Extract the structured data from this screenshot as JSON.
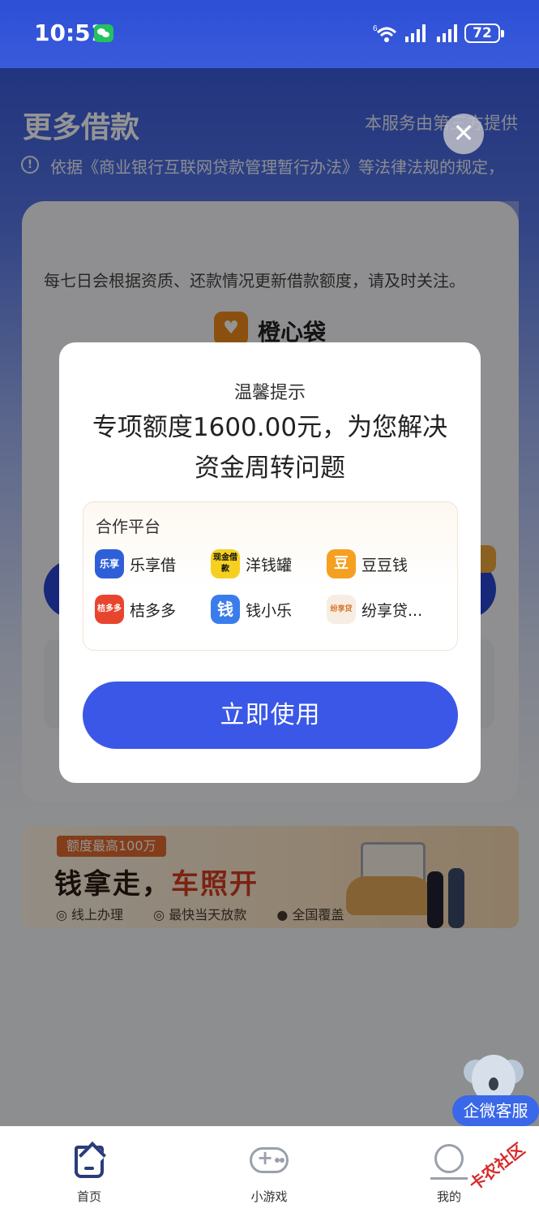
{
  "status_bar": {
    "time": "10:51",
    "battery": "72",
    "wifi_label": "6"
  },
  "page": {
    "title": "更多借款",
    "provider_note": "本服务由第三方提供",
    "notice": "依据《商业银行互联网贷款管理暂行办法》等法律法规的规定，",
    "card_tip": "每七日会根据资质、还款情况更新借款额度，请及时关注。",
    "brand_name": "橙心袋"
  },
  "banner": {
    "tag": "额度最高100万",
    "headline_a": "钱拿走，",
    "headline_b": "车照开",
    "points": [
      "线上办理",
      "最快当天放款",
      "全国覆盖"
    ]
  },
  "dialog": {
    "title": "温馨提示",
    "headline": "专项额度1600.00元，为您解决资金周转问题",
    "partner_title": "合作平台",
    "partners": [
      {
        "name": "乐享借",
        "icon": "乐享",
        "color": "#2f5fd8"
      },
      {
        "name": "洋钱罐",
        "icon": "现金借款",
        "color": "#f5d021"
      },
      {
        "name": "豆豆钱",
        "icon": "豆",
        "color": "#f5a020"
      },
      {
        "name": "桔多多",
        "icon": "桔多多",
        "color": "#e8452e"
      },
      {
        "name": "钱小乐",
        "icon": "钱",
        "color": "#3a7cec"
      },
      {
        "name": "纷享贷...",
        "icon": "纷享贷",
        "color": "#f7ede2"
      }
    ],
    "cta": "立即使用"
  },
  "service": {
    "label": "企微客服"
  },
  "tabbar": {
    "items": [
      "首页",
      "小游戏",
      "我的"
    ]
  },
  "watermark": "卡农社区"
}
